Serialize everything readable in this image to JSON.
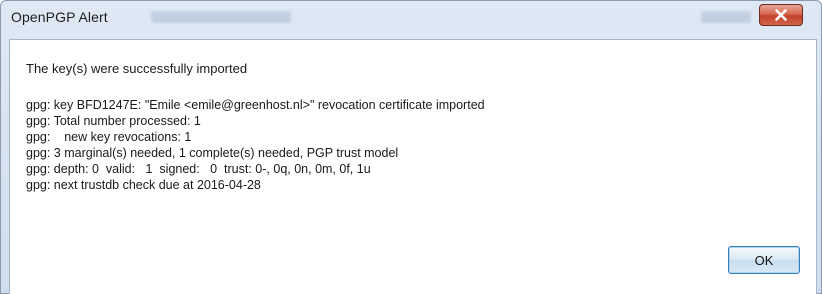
{
  "window": {
    "title": "OpenPGP Alert"
  },
  "icons": {
    "close": "close-icon"
  },
  "colors": {
    "close_button": "#c94a33",
    "titlebar": "#dbe6f3",
    "ok_border": "#3c7fb1"
  },
  "message": {
    "headline": "The key(s) were successfully imported",
    "lines": [
      "gpg: key BFD1247E: \"Emile <emile@greenhost.nl>\" revocation certificate imported",
      "gpg: Total number processed: 1",
      "gpg:    new key revocations: 1",
      "gpg: 3 marginal(s) needed, 1 complete(s) needed, PGP trust model",
      "gpg: depth: 0  valid:   1  signed:   0  trust: 0-, 0q, 0n, 0m, 0f, 1u",
      "gpg: next trustdb check due at 2016-04-28"
    ]
  },
  "buttons": {
    "ok_label": "OK"
  }
}
